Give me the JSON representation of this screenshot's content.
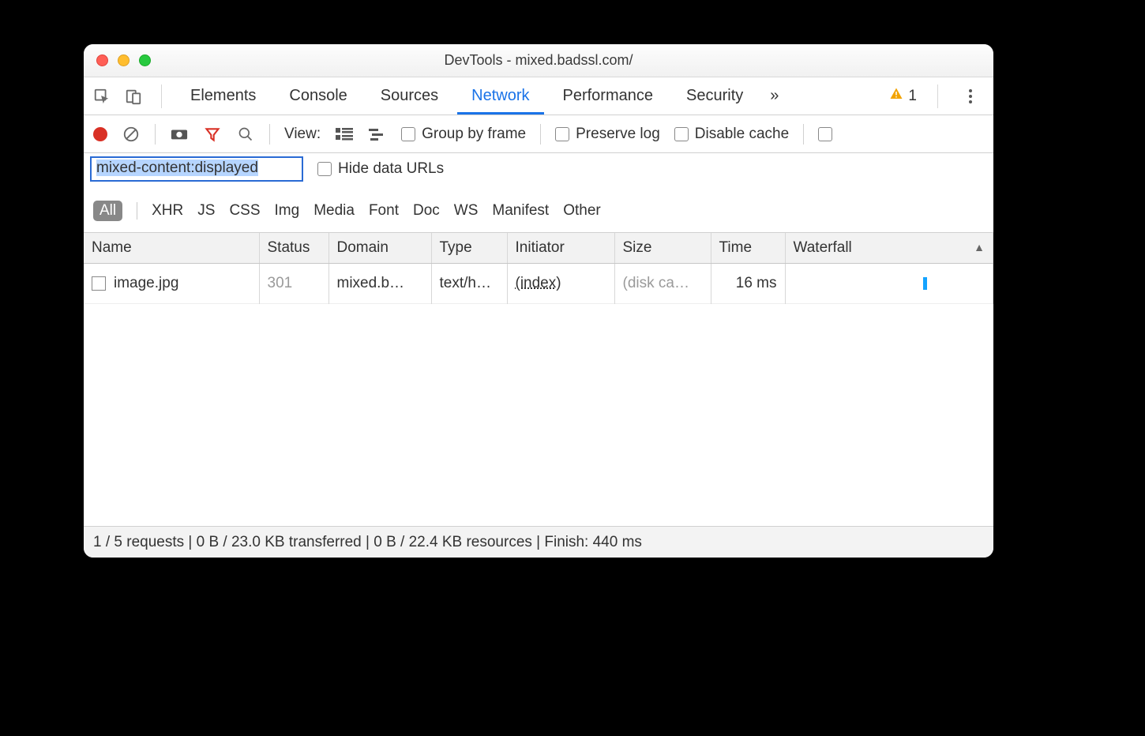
{
  "window": {
    "title": "DevTools - mixed.badssl.com/"
  },
  "tabs": {
    "items": [
      "Elements",
      "Console",
      "Sources",
      "Network",
      "Performance",
      "Security"
    ],
    "active": "Network",
    "overflow_glyph": "»",
    "warning_count": "1"
  },
  "toolbar": {
    "view_label": "View:",
    "group_by_frame": "Group by frame",
    "preserve_log": "Preserve log",
    "disable_cache": "Disable cache"
  },
  "filter": {
    "value": "mixed-content:displayed",
    "hide_data_urls": "Hide data URLs",
    "types": [
      "All",
      "XHR",
      "JS",
      "CSS",
      "Img",
      "Media",
      "Font",
      "Doc",
      "WS",
      "Manifest",
      "Other"
    ],
    "active_type": "All"
  },
  "columns": {
    "name": "Name",
    "status": "Status",
    "domain": "Domain",
    "type": "Type",
    "initiator": "Initiator",
    "size": "Size",
    "time": "Time",
    "waterfall": "Waterfall"
  },
  "rows": [
    {
      "name": "image.jpg",
      "status": "301",
      "domain": "mixed.b…",
      "type": "text/h…",
      "initiator": "(index)",
      "size": "(disk ca…",
      "time": "16 ms",
      "waterfall": {
        "left_pct": 68,
        "width_pct": 2
      }
    }
  ],
  "statusbar": "1 / 5 requests | 0 B / 23.0 KB transferred | 0 B / 22.4 KB resources | Finish: 440 ms"
}
